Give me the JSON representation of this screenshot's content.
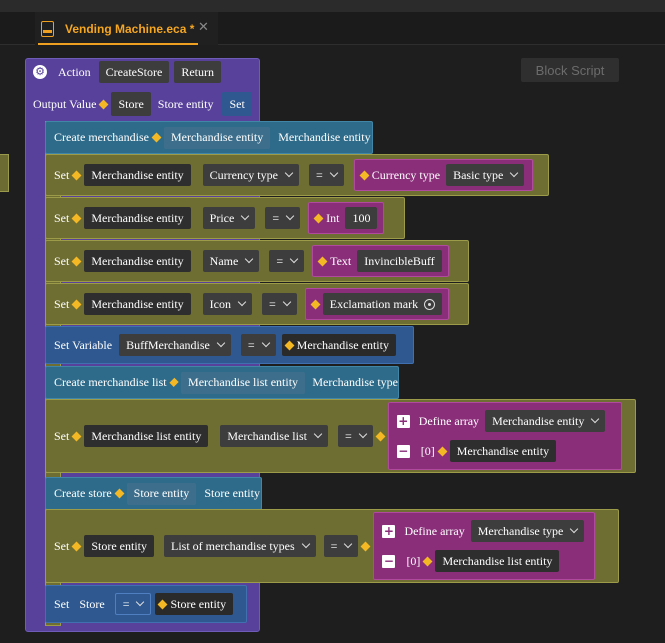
{
  "tab": {
    "title": "Vending Machine.eca *",
    "close": "✕"
  },
  "block_script": "Block Script",
  "action": {
    "label": "Action",
    "name": "CreateStore",
    "return": "Return"
  },
  "output": {
    "label": "Output Value",
    "var": "Store",
    "type": "Store entity",
    "set": "Set"
  },
  "create_merch": {
    "label": "Create merchandise",
    "var": "Merchandise entity",
    "type": "Merchandise entity"
  },
  "set1": {
    "set": "Set",
    "target": "Merchandise entity",
    "field": "Currency type",
    "op": "=",
    "vtype": "Currency type",
    "value": "Basic type"
  },
  "set2": {
    "set": "Set",
    "target": "Merchandise entity",
    "field": "Price",
    "op": "=",
    "vtype": "Int",
    "value": "100"
  },
  "set3": {
    "set": "Set",
    "target": "Merchandise entity",
    "field": "Name",
    "op": "=",
    "vtype": "Text",
    "value": "InvincibleBuff"
  },
  "set4": {
    "set": "Set",
    "target": "Merchandise entity",
    "field": "Icon",
    "op": "=",
    "value": "Exclamation mark"
  },
  "setvar": {
    "label": "Set Variable",
    "var": "BuffMerchandise",
    "op": "=",
    "value": "Merchandise entity"
  },
  "create_list": {
    "label": "Create merchandise list",
    "var": "Merchandise list entity",
    "type": "Merchandise type"
  },
  "set5": {
    "set": "Set",
    "target": "Merchandise list entity",
    "field": "Merchandise list",
    "op": "=",
    "define": "Define array",
    "atype": "Merchandise entity",
    "index": "[0]",
    "item": "Merchandise entity"
  },
  "create_store": {
    "label": "Create store",
    "var": "Store entity",
    "type": "Store entity"
  },
  "set6": {
    "set": "Set",
    "target": "Store entity",
    "field": "List of merchandise types",
    "op": "=",
    "define": "Define array",
    "atype": "Merchandise type",
    "index": "[0]",
    "item": "Merchandise list entity"
  },
  "set7": {
    "set": "Set",
    "target": "Store",
    "op": "=",
    "value": "Store entity"
  }
}
